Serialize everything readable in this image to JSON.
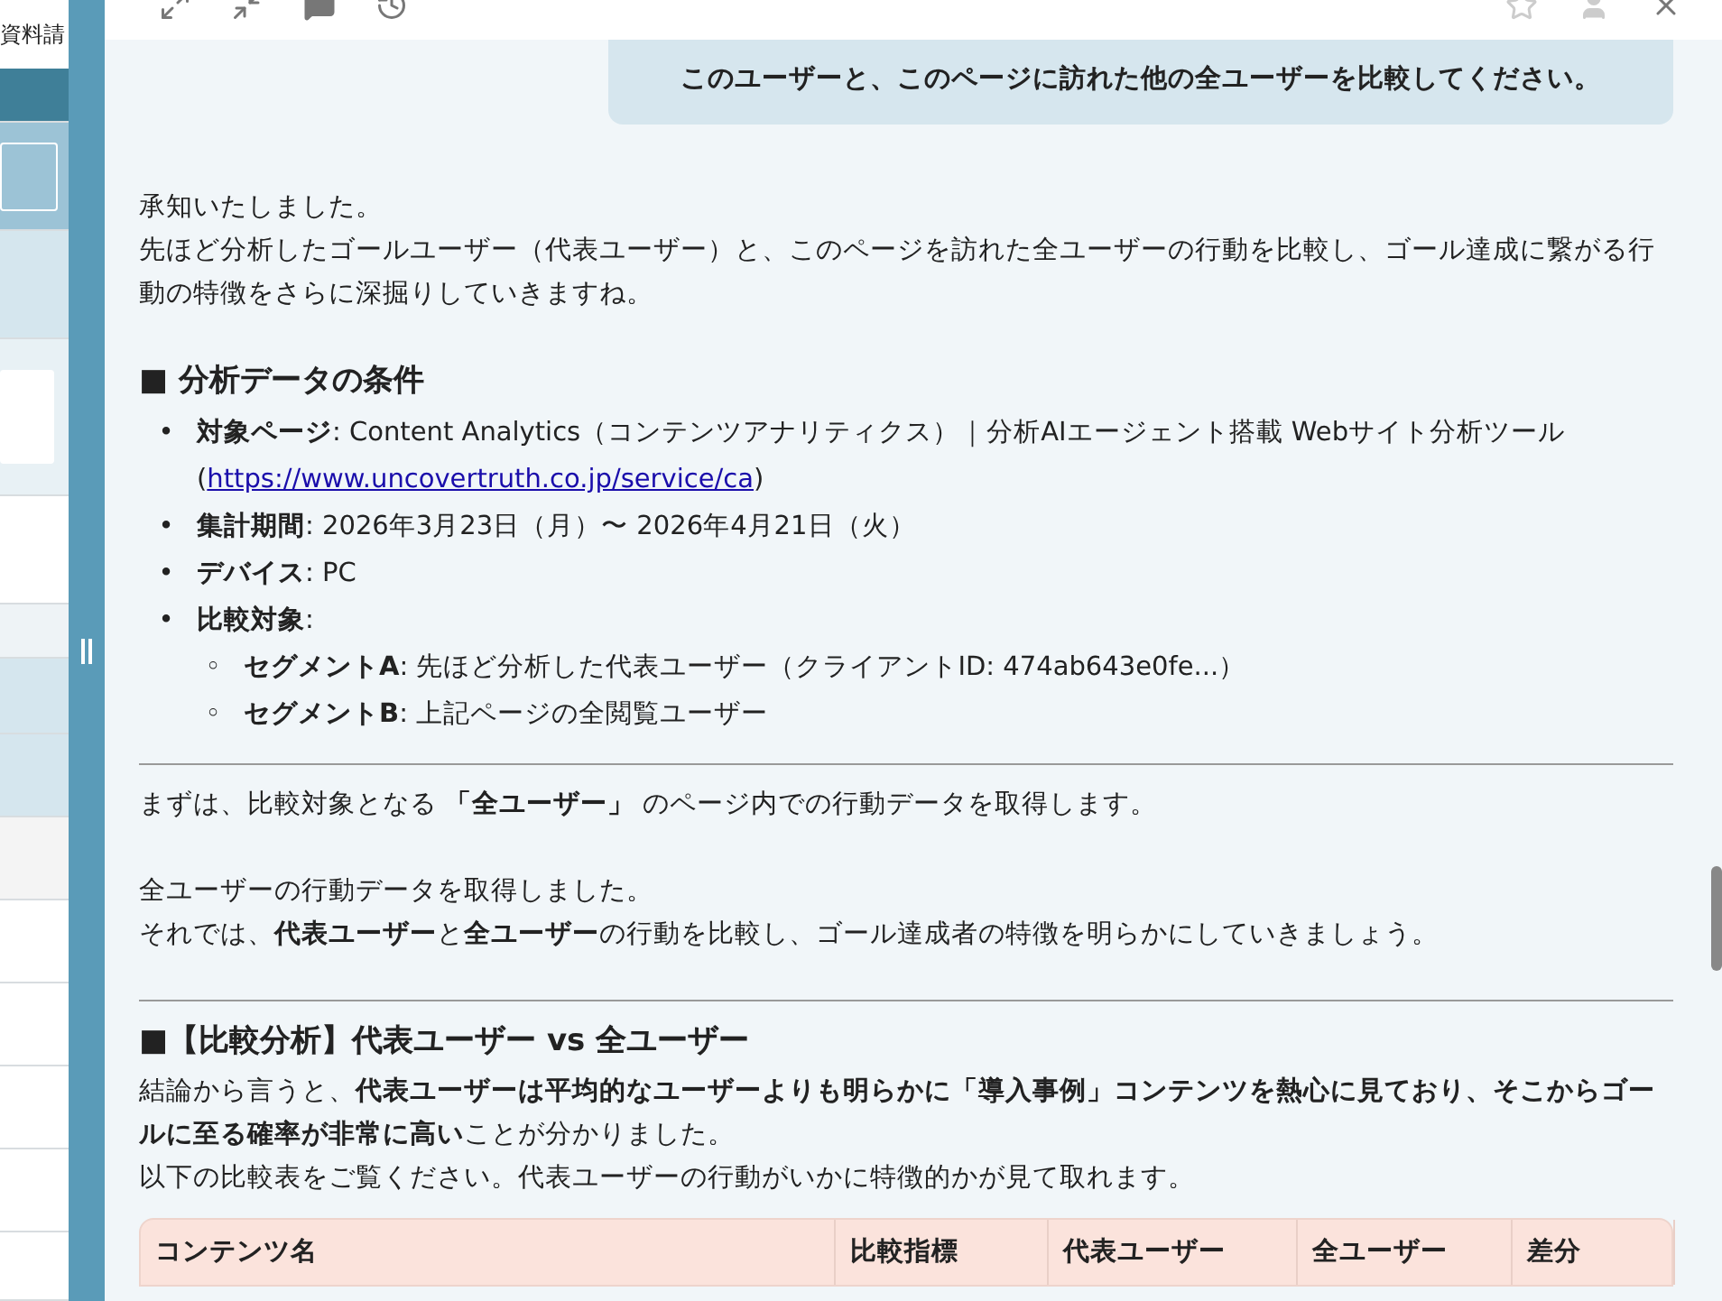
{
  "left_panel": {
    "title": "資料請"
  },
  "user_message": {
    "text": "このユーザーと、このページに訪れた他の全ユーザーを比較してください。"
  },
  "response": [
    {
      "kind": "paragraph",
      "lines": [
        "承知いたしました。",
        "先ほど分析したゴールユーザー（代表ユーザー）と、このページを訪れた全ユーザーの行動を比較し、ゴール達成に繋がる行動の特徴をさらに深掘りしていきますね。"
      ]
    },
    {
      "kind": "heading",
      "text": "■ 分析データの条件"
    },
    {
      "kind": "list",
      "items": [
        {
          "marker": "•",
          "parts": [
            {
              "text": "**対象ページ**: Content Analytics（コンテンツアナリティクス）｜分析AIエージェント搭載 Webサイト分析ツール ("
            },
            {
              "link": "https://www.uncovertruth.co.jp/service/ca"
            },
            {
              "text": ")"
            }
          ]
        },
        {
          "marker": "•",
          "parts": [
            {
              "text": "**集計期間**: 2026年3月23日（月）〜 2026年4月21日（火）"
            }
          ]
        },
        {
          "marker": "•",
          "parts": [
            {
              "text": "**デバイス**: PC"
            }
          ]
        },
        {
          "marker": "•",
          "parts": [
            {
              "text": "**比較対象**:"
            }
          ],
          "children": [
            {
              "marker": "◦",
              "parts": [
                {
                  "text": "**セグメントA**: 先ほど分析した代表ユーザー（クライアントID: 474ab643e0fe...）"
                }
              ]
            },
            {
              "marker": "◦",
              "parts": [
                {
                  "text": "**セグメントB**: 上記ページの全閲覧ユーザー"
                }
              ]
            }
          ]
        }
      ]
    },
    {
      "kind": "divider"
    },
    {
      "kind": "paragraph",
      "lines": [
        "まずは、比較対象となる **「全ユーザー」** のページ内での行動データを取得します。"
      ]
    },
    {
      "kind": "paragraph",
      "lines": [
        "全ユーザーの行動データを取得しました。",
        "それでは、**代表ユーザー**と**全ユーザー**の行動を比較し、ゴール達成者の特徴を明らかにしていきましょう。"
      ]
    },
    {
      "kind": "divider"
    },
    {
      "kind": "heading",
      "text": "■【比較分析】代表ユーザー vs 全ユーザー"
    },
    {
      "kind": "paragraph",
      "lines": [
        "結論から言うと、**代表ユーザーは平均的なユーザーよりも明らかに「導入事例」コンテンツを熱心に見ており、そこからゴールに至る確率が非常に高い**ことが分かりました。",
        "以下の比較表をご覧ください。代表ユーザーの行動がいかに特徴的かが見て取れます。"
      ]
    },
    {
      "kind": "table",
      "columns": [
        "コンテンツ名",
        "比較指標",
        "代表ユーザー",
        "全ユーザー",
        "差分"
      ]
    }
  ]
}
